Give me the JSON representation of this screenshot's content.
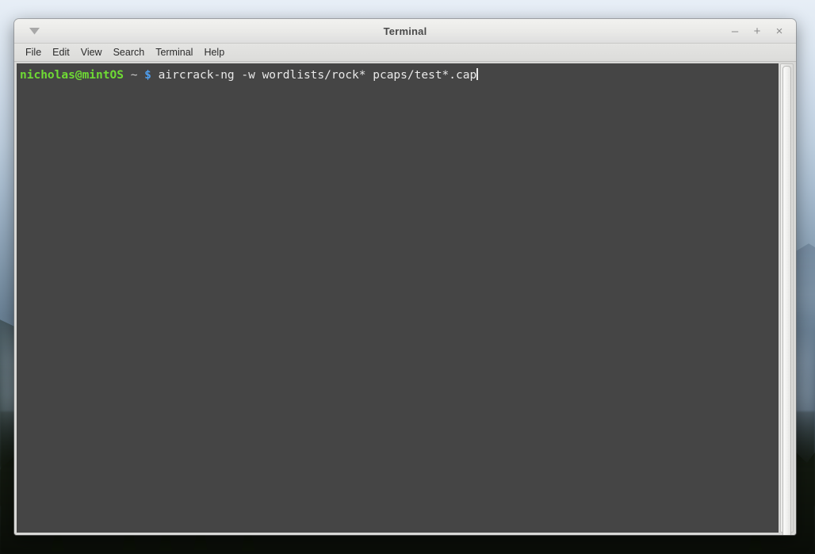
{
  "window": {
    "title": "Terminal",
    "menu_arrow_icon": "chevron-down-icon",
    "buttons": {
      "minimize": "–",
      "maximize": "+",
      "close": "×"
    }
  },
  "menubar": {
    "items": [
      {
        "label": "File"
      },
      {
        "label": "Edit"
      },
      {
        "label": "View"
      },
      {
        "label": "Search"
      },
      {
        "label": "Terminal"
      },
      {
        "label": "Help"
      }
    ]
  },
  "terminal": {
    "prompt": {
      "user_host": "nicholas@mintOS",
      "path": "~",
      "symbol": "$"
    },
    "command": "aircrack-ng -w wordlists/rock* pcaps/test*.cap",
    "cursor": "block-caret",
    "colors": {
      "background": "#454545",
      "user_host": "#6fdb34",
      "path": "#c9c9c9",
      "symbol": "#4e9ff0",
      "text": "#e9e9e9"
    }
  },
  "scrollbar": {
    "orientation": "vertical",
    "thumb_position": "top"
  },
  "desktop": {
    "wallpaper": "misty-mountain-forest"
  }
}
